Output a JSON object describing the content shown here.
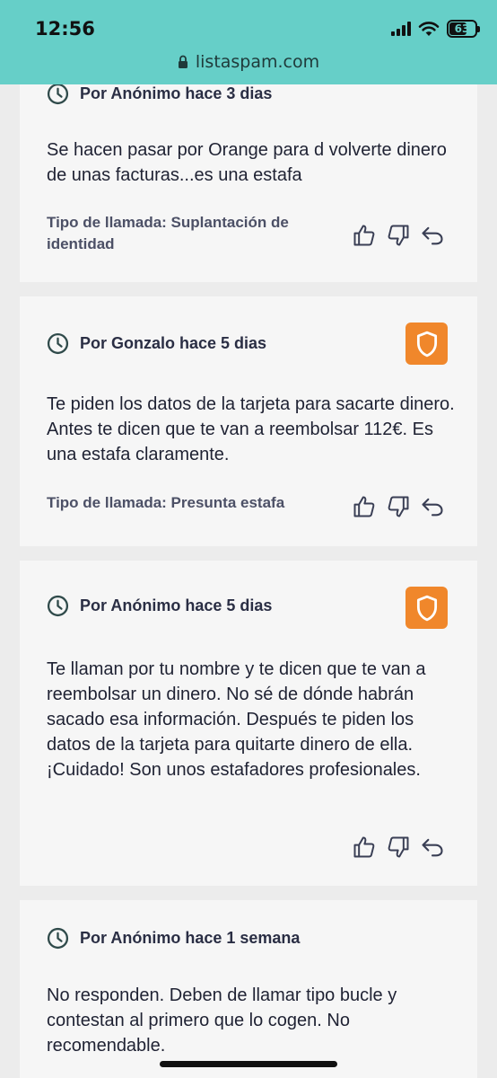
{
  "status_bar": {
    "time": "12:56",
    "battery": "63"
  },
  "browser": {
    "url": "listaspam.com"
  },
  "comments": [
    {
      "meta": "Por Anónimo hace 3 dias",
      "text": "Se hacen pasar por Orange para d volverte dinero de unas facturas...es una estafa",
      "call_type": "Tipo de llamada: Suplantación de identidad"
    },
    {
      "meta": "Por Gonzalo hace 5 dias",
      "text": "Te piden los datos de la tarjeta para sacarte dinero. Antes te dicen que te van a reembolsar 112€. Es una estafa claramente.",
      "call_type": "Tipo de llamada: Presunta estafa"
    },
    {
      "meta": "Por Anónimo hace 5 dias",
      "text": "Te llaman por tu nombre y te dicen que te van a reembolsar un dinero. No sé de dónde habrán sacado esa información. Después te piden los datos de la tarjeta para quitarte dinero de ella. ¡Cuidado! Son unos estafadores profesionales.",
      "call_type": ""
    },
    {
      "meta": "Por Anónimo hace 1 semana",
      "text": "No responden. Deben de llamar tipo bucle y contestan al primero que lo cogen. No recomendable."
    }
  ],
  "icons": {
    "clock": "clock-icon",
    "like": "thumbs-up-icon",
    "dislike": "thumbs-down-icon",
    "reply": "reply-icon",
    "shield": "shield-icon",
    "lock": "lock-icon"
  },
  "colors": {
    "top_bar": "#66cfc8",
    "badge": "#f0872b",
    "card": "#f6f6f6",
    "page": "#ececec"
  }
}
